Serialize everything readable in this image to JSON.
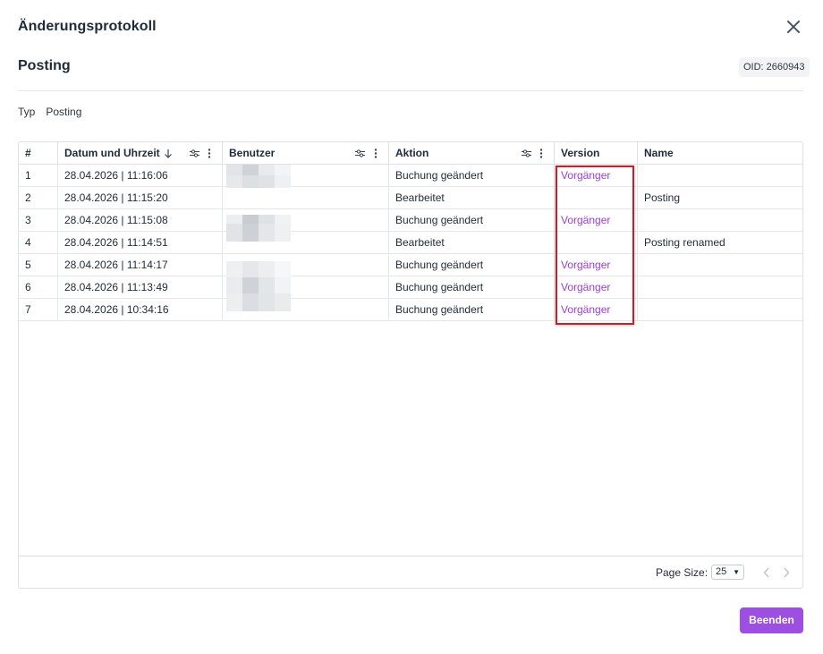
{
  "dialog": {
    "title": "Änderungsprotokoll",
    "subtitle": "Posting",
    "oid_label": "OID: 2660943",
    "meta_label": "Typ",
    "meta_value": "Posting"
  },
  "columns": [
    "#",
    "Datum und Uhrzeit",
    "Benutzer",
    "Aktion",
    "Version",
    "Name"
  ],
  "rows": [
    {
      "num": "1",
      "datetime": "28.04.2026 | 11:16:06",
      "action": "Buchung geändert",
      "version": "Vorgänger",
      "name": ""
    },
    {
      "num": "2",
      "datetime": "28.04.2026 | 11:15:20",
      "action": "Bearbeitet",
      "version": "",
      "name": "Posting"
    },
    {
      "num": "3",
      "datetime": "28.04.2026 | 11:15:08",
      "action": "Buchung geändert",
      "version": "Vorgänger",
      "name": ""
    },
    {
      "num": "4",
      "datetime": "28.04.2026 | 11:14:51",
      "action": "Bearbeitet",
      "version": "",
      "name": "Posting renamed"
    },
    {
      "num": "5",
      "datetime": "28.04.2026 | 11:14:17",
      "action": "Buchung geändert",
      "version": "Vorgänger",
      "name": ""
    },
    {
      "num": "6",
      "datetime": "28.04.2026 | 11:13:49",
      "action": "Buchung geändert",
      "version": "Vorgänger",
      "name": ""
    },
    {
      "num": "7",
      "datetime": "28.04.2026 | 10:34:16",
      "action": "Buchung geändert",
      "version": "Vorgänger",
      "name": ""
    }
  ],
  "footer": {
    "page_size_label": "Page Size:",
    "page_size_value": "25"
  },
  "buttons": {
    "end_label": "Beenden"
  },
  "icons": {
    "close": "close-icon",
    "sort": "arrow-down-icon",
    "filter": "filter-icon",
    "menu": "kebab-menu-icon",
    "prev": "chevron-left-icon",
    "next": "chevron-right-icon"
  },
  "colors": {
    "accent": "#9c4fe0",
    "link": "#9b3fd6",
    "highlight": "#c8202a"
  }
}
